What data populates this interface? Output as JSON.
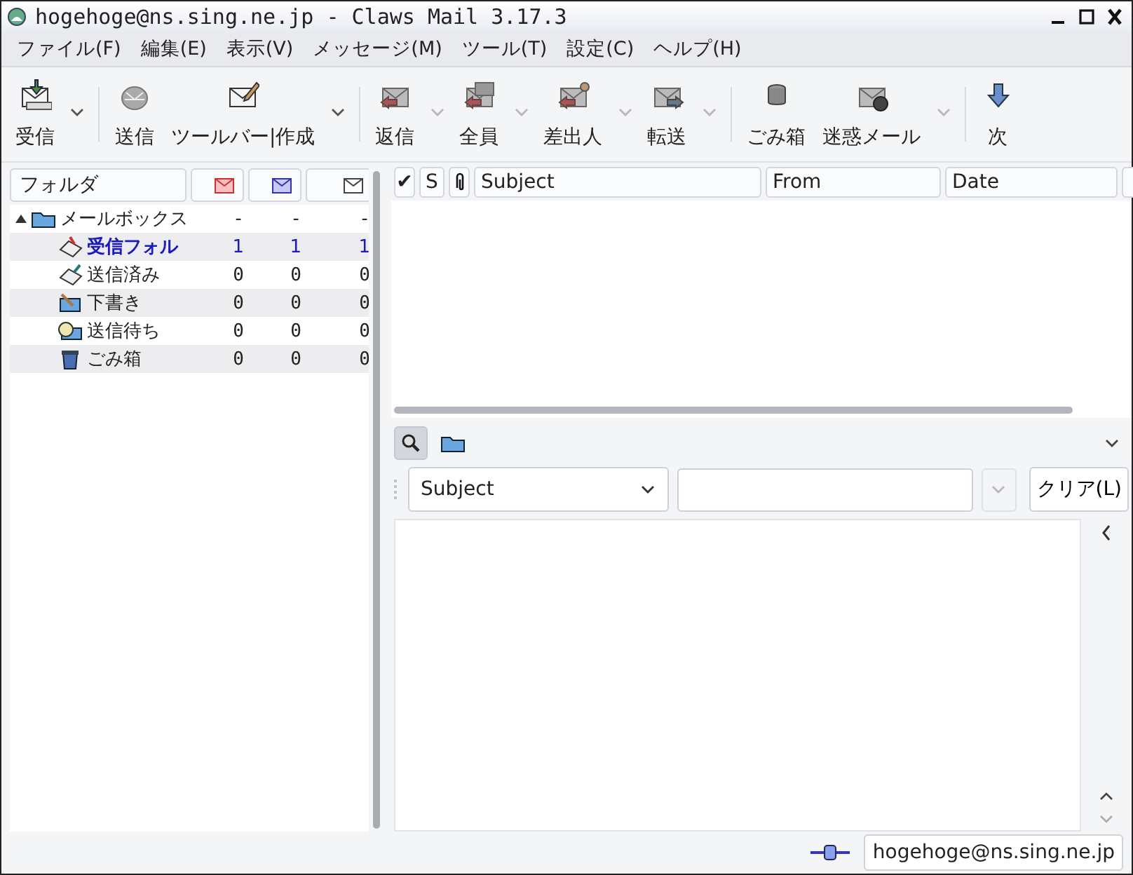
{
  "window": {
    "title": "hogehoge@ns.sing.ne.jp - Claws Mail 3.17.3"
  },
  "menu": [
    "ファイル(F)",
    "編集(E)",
    "表示(V)",
    "メッセージ(M)",
    "ツール(T)",
    "設定(C)",
    "ヘルプ(H)"
  ],
  "toolbar": {
    "items": [
      {
        "kind": "button",
        "label": "受信",
        "dropdown": true,
        "dropdown_disabled": false
      },
      {
        "kind": "separator"
      },
      {
        "kind": "button",
        "label": "送信",
        "dropdown": false
      },
      {
        "kind": "button",
        "label": "ツールバー|作成",
        "dropdown": true,
        "dropdown_disabled": false
      },
      {
        "kind": "separator"
      },
      {
        "kind": "button",
        "label": "返信",
        "dropdown": true,
        "dropdown_disabled": true
      },
      {
        "kind": "button",
        "label": "全員",
        "dropdown": true,
        "dropdown_disabled": true
      },
      {
        "kind": "button",
        "label": "差出人",
        "dropdown": true,
        "dropdown_disabled": true
      },
      {
        "kind": "button",
        "label": "転送",
        "dropdown": true,
        "dropdown_disabled": true
      },
      {
        "kind": "separator"
      },
      {
        "kind": "button",
        "label": "ごみ箱",
        "dropdown": false
      },
      {
        "kind": "button",
        "label": "迷惑メール",
        "dropdown": true,
        "dropdown_disabled": true
      },
      {
        "kind": "separator"
      },
      {
        "kind": "button",
        "label": "次",
        "dropdown": false
      }
    ]
  },
  "folders": {
    "header": "フォルダ",
    "tree": [
      {
        "name": "メールボックス",
        "new": "-",
        "unread": "-",
        "total": "-",
        "expanded": true,
        "highlighted": false,
        "children": [
          {
            "name": "受信フォル",
            "new": "1",
            "unread": "1",
            "total": "1",
            "highlighted": true
          },
          {
            "name": "送信済み",
            "new": "0",
            "unread": "0",
            "total": "0",
            "highlighted": false
          },
          {
            "name": "下書き",
            "new": "0",
            "unread": "0",
            "total": "0",
            "highlighted": false
          },
          {
            "name": "送信待ち",
            "new": "0",
            "unread": "0",
            "total": "0",
            "highlighted": false
          },
          {
            "name": "ごみ箱",
            "new": "0",
            "unread": "0",
            "total": "0",
            "highlighted": false
          }
        ]
      }
    ]
  },
  "message_list": {
    "columns": [
      {
        "kind": "text",
        "label": "✔"
      },
      {
        "kind": "text",
        "label": "S"
      },
      {
        "kind": "attachment"
      },
      {
        "kind": "text",
        "label": "Subject"
      },
      {
        "kind": "text",
        "label": "From"
      },
      {
        "kind": "text",
        "label": "Date"
      },
      {
        "kind": "blank"
      }
    ]
  },
  "quick_search": {
    "search_selected": true,
    "field": "Subject",
    "clear_button": "クリア(L)"
  },
  "status_bar": {
    "online": true,
    "account": "hogehoge@ns.sing.ne.jp"
  }
}
